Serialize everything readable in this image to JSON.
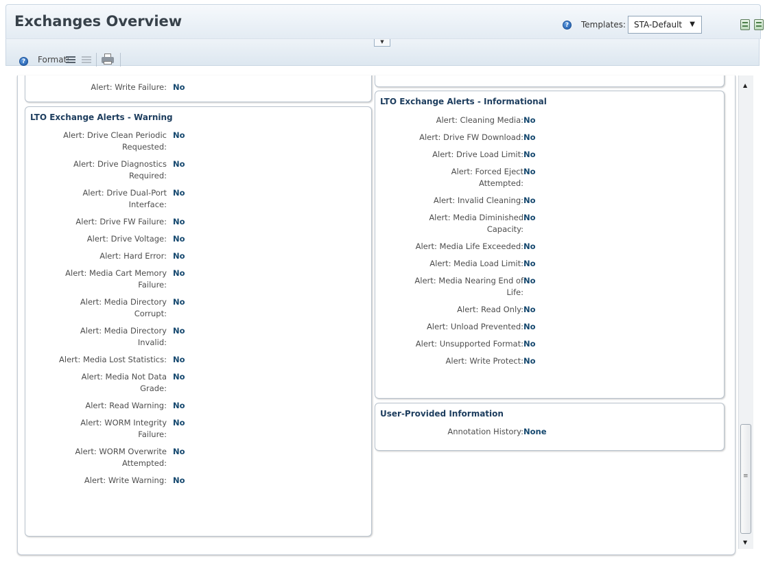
{
  "header": {
    "title": "Exchanges Overview",
    "templates_label": "Templates:",
    "templates_selected": "STA-Default",
    "help_glyph": "?"
  },
  "toolbar": {
    "format_label": "Format:",
    "help_glyph": "?"
  },
  "sections": {
    "top_left_row": {
      "label": "Alert: Write Failure:",
      "value": "No"
    },
    "warning": {
      "title": "LTO Exchange Alerts - Warning",
      "rows": [
        {
          "label1": "Alert: Drive Clean Periodic",
          "label2": "Requested:",
          "value": "No"
        },
        {
          "label1": "Alert: Drive Diagnostics",
          "label2": "Required:",
          "value": "No"
        },
        {
          "label1": "Alert: Drive Dual-Port",
          "label2": "Interface:",
          "value": "No"
        },
        {
          "label1": "Alert: Drive FW Failure:",
          "label2": "",
          "value": "No"
        },
        {
          "label1": "Alert: Drive Voltage:",
          "label2": "",
          "value": "No"
        },
        {
          "label1": "Alert: Hard Error:",
          "label2": "",
          "value": "No"
        },
        {
          "label1": "Alert: Media Cart Memory",
          "label2": "Failure:",
          "value": "No"
        },
        {
          "label1": "Alert: Media Directory",
          "label2": "Corrupt:",
          "value": "No"
        },
        {
          "label1": "Alert: Media Directory",
          "label2": "Invalid:",
          "value": "No"
        },
        {
          "label1": "Alert: Media Lost Statistics:",
          "label2": "",
          "value": "No"
        },
        {
          "label1": "Alert: Media Not Data",
          "label2": "Grade:",
          "value": "No"
        },
        {
          "label1": "Alert: Read Warning:",
          "label2": "",
          "value": "No"
        },
        {
          "label1": "Alert: WORM Integrity",
          "label2": "Failure:",
          "value": "No"
        },
        {
          "label1": "Alert: WORM Overwrite",
          "label2": "Attempted:",
          "value": "No"
        },
        {
          "label1": "Alert: Write Warning:",
          "label2": "",
          "value": "No"
        }
      ]
    },
    "informational": {
      "title": "LTO Exchange Alerts - Informational",
      "rows": [
        {
          "label1": "Alert: Cleaning Media:",
          "label2": "",
          "value": "No"
        },
        {
          "label1": "Alert: Drive FW Download:",
          "label2": "",
          "value": "No"
        },
        {
          "label1": "Alert: Drive Load Limit:",
          "label2": "",
          "value": "No"
        },
        {
          "label1": "Alert: Forced Eject",
          "label2": "Attempted:",
          "value": "No"
        },
        {
          "label1": "Alert: Invalid Cleaning:",
          "label2": "",
          "value": "No"
        },
        {
          "label1": "Alert: Media Diminished",
          "label2": "Capacity:",
          "value": "No"
        },
        {
          "label1": "Alert: Media Life Exceeded:",
          "label2": "",
          "value": "No"
        },
        {
          "label1": "Alert: Media Load Limit:",
          "label2": "",
          "value": "No"
        },
        {
          "label1": "Alert: Media Nearing End of",
          "label2": "Life:",
          "value": "No"
        },
        {
          "label1": "Alert: Read Only:",
          "label2": "",
          "value": "No"
        },
        {
          "label1": "Alert: Unload Prevented:",
          "label2": "",
          "value": "No"
        },
        {
          "label1": "Alert: Unsupported Format:",
          "label2": "",
          "value": "No"
        },
        {
          "label1": "Alert: Write Protect:",
          "label2": "",
          "value": "No"
        }
      ]
    },
    "user_info": {
      "title": "User-Provided Information",
      "rows": [
        {
          "label1": "Annotation History:",
          "label2": "",
          "value": "None"
        }
      ]
    }
  }
}
